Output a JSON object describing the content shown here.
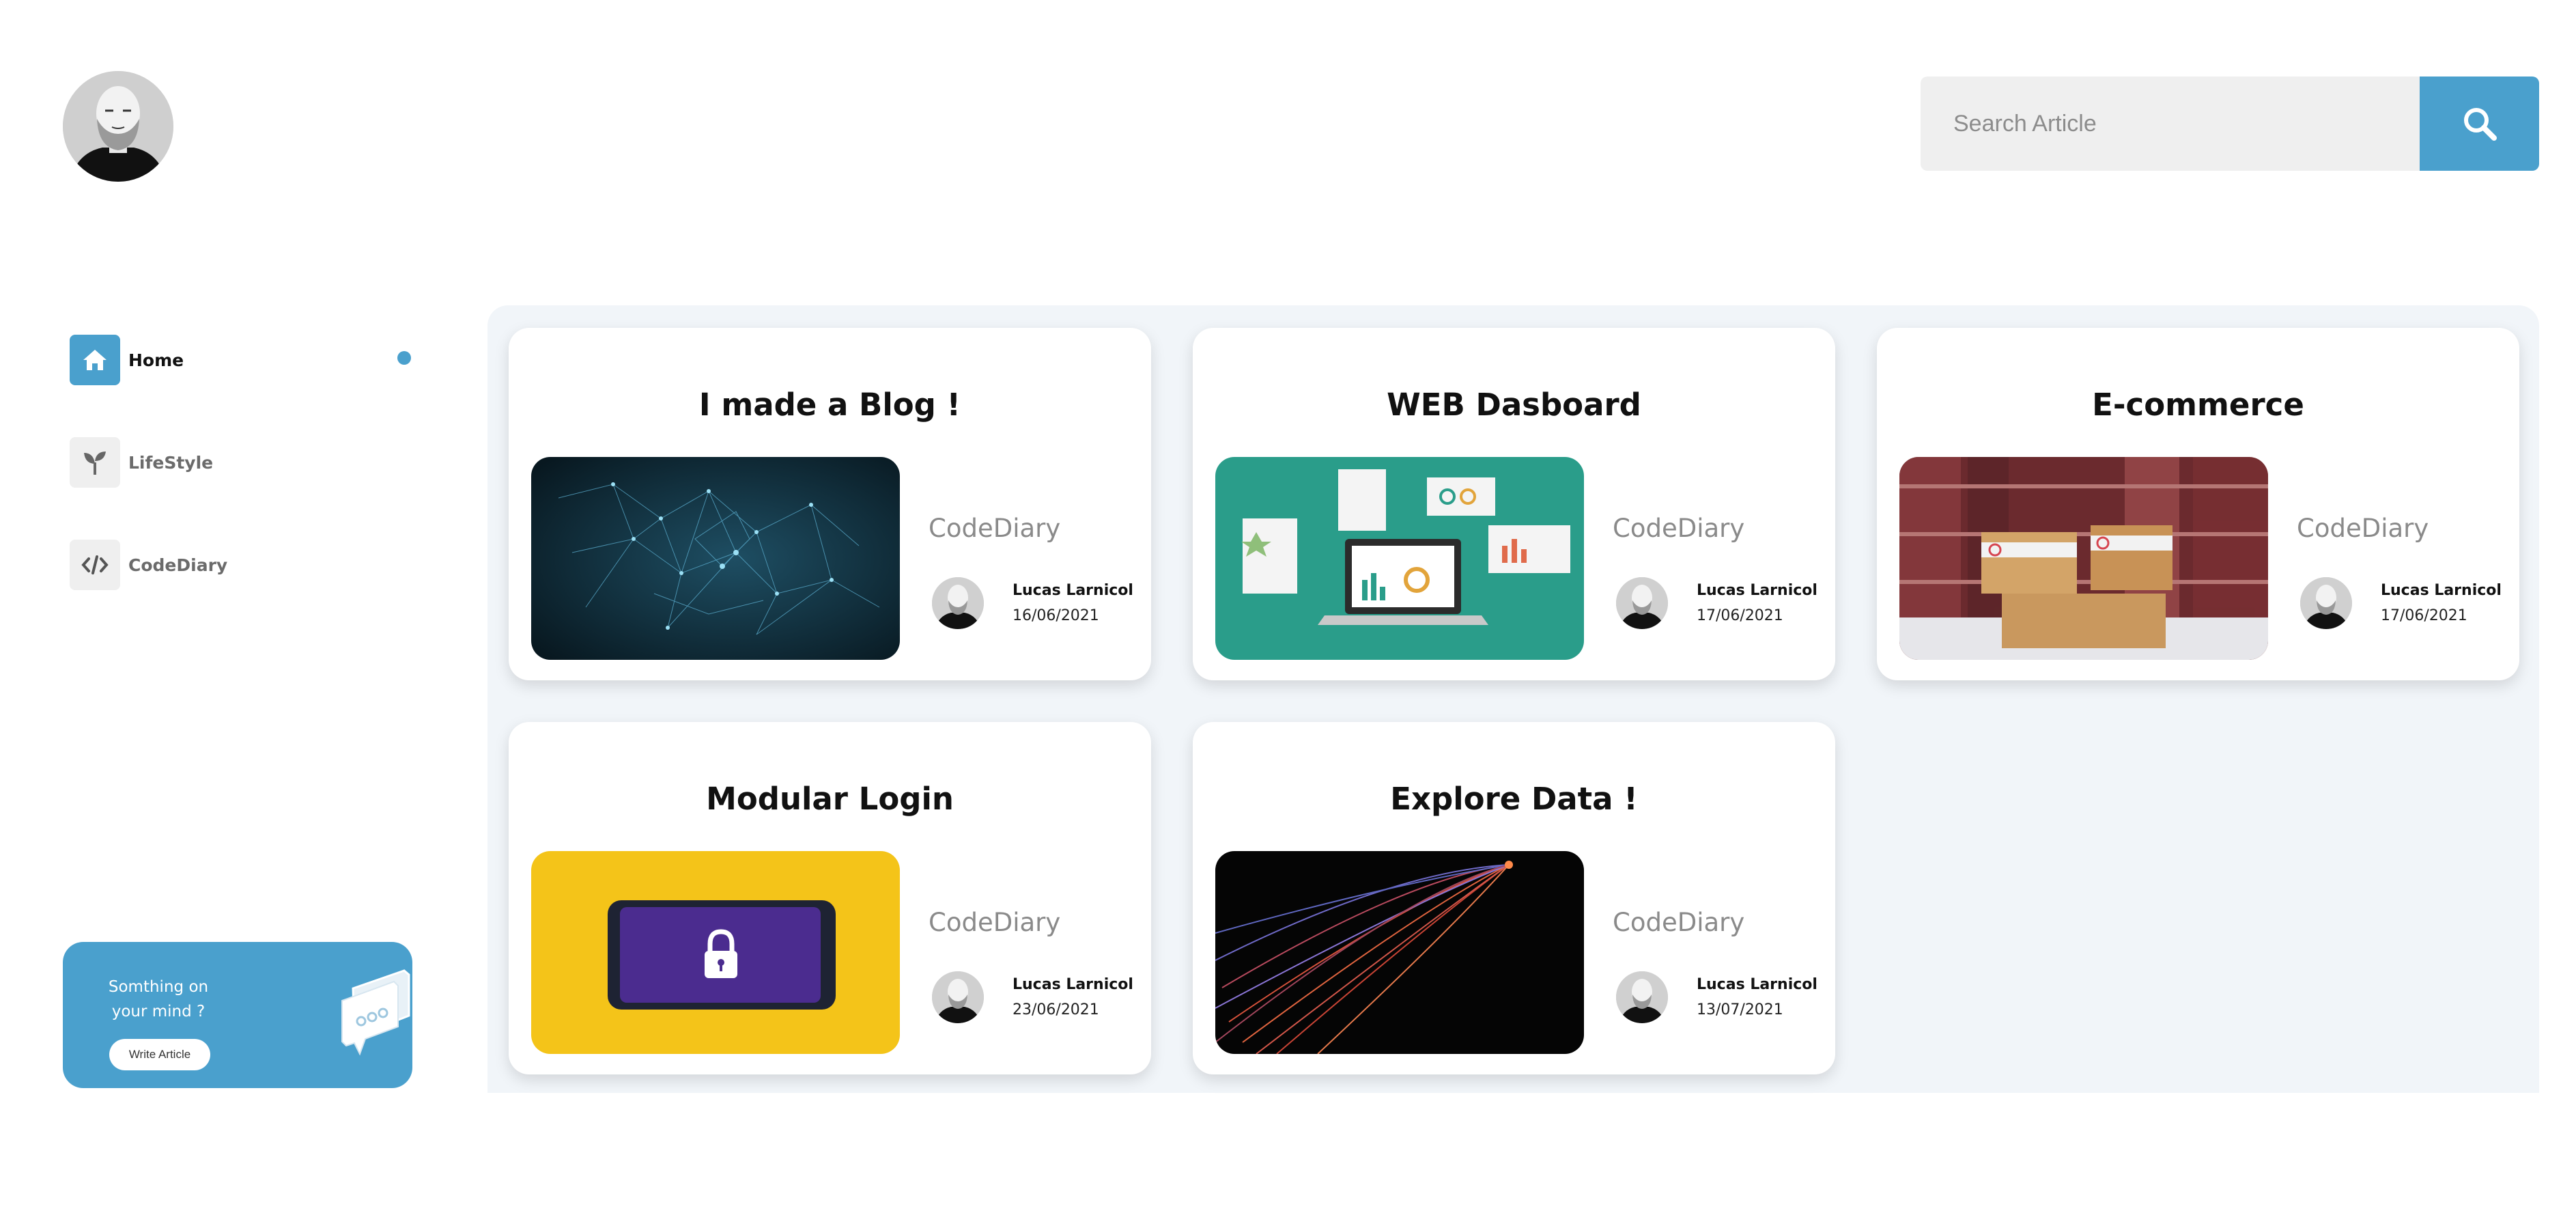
{
  "header": {
    "search": {
      "placeholder": "Search Article"
    }
  },
  "sidebar": {
    "items": [
      {
        "label": "Home",
        "icon": "home-icon",
        "active": true
      },
      {
        "label": "LifeStyle",
        "icon": "sprout-icon",
        "active": false
      },
      {
        "label": "CodeDiary",
        "icon": "code-icon",
        "active": false
      }
    ],
    "cta": {
      "text": "Somthing on your mind ?",
      "button_label": "Write Article"
    }
  },
  "articles": [
    {
      "title": "I made a Blog !",
      "category": "CodeDiary",
      "author": "Lucas Larnicol",
      "date": "16/06/2021",
      "image": "network-visualization"
    },
    {
      "title": "WEB Dasboard",
      "category": "CodeDiary",
      "author": "Lucas Larnicol",
      "date": "17/06/2021",
      "image": "dashboard-laptop"
    },
    {
      "title": "E-commerce",
      "category": "CodeDiary",
      "author": "Lucas Larnicol",
      "date": "17/06/2021",
      "image": "shipping-boxes"
    },
    {
      "title": "Modular Login",
      "category": "CodeDiary",
      "author": "Lucas Larnicol",
      "date": "23/06/2021",
      "image": "phone-lock"
    },
    {
      "title": "Explore Data !",
      "category": "CodeDiary",
      "author": "Lucas Larnicol",
      "date": "13/07/2021",
      "image": "light-trails"
    }
  ],
  "colors": {
    "accent": "#4aa0cd",
    "panel_bg": "#f1f5f9",
    "input_bg": "#efefef"
  }
}
